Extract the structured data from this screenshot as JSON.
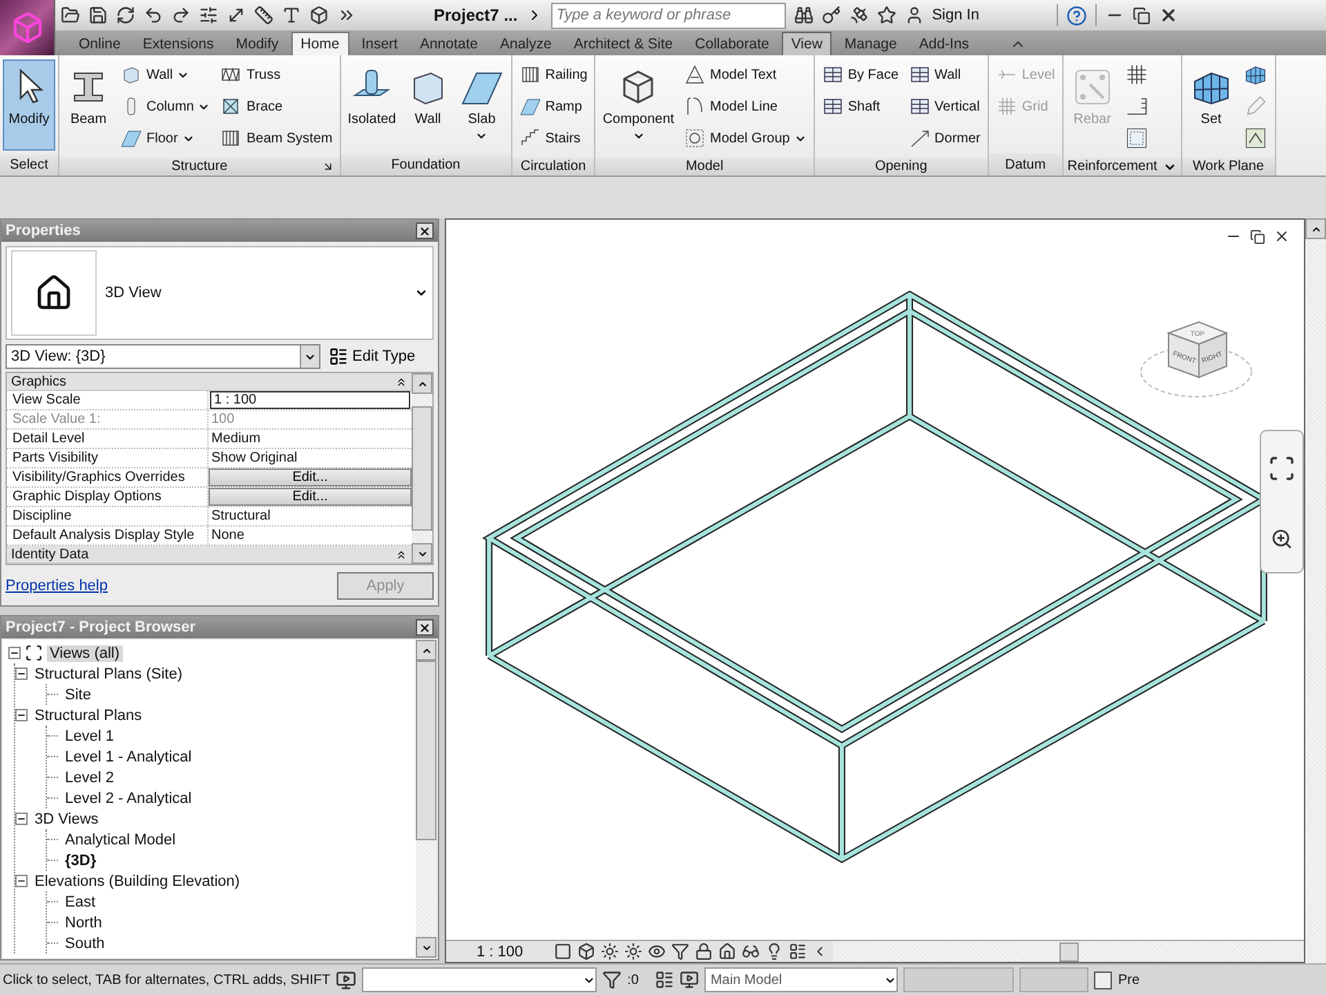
{
  "app": {
    "title": "Project7 ...",
    "search": {
      "placeholder": "Type a keyword or phrase"
    },
    "sign_in": "Sign In"
  },
  "tabs": [
    {
      "label": "Online",
      "selected": false,
      "hovered": false
    },
    {
      "label": "Extensions",
      "selected": false,
      "hovered": false
    },
    {
      "label": "Modify",
      "selected": false,
      "hovered": false
    },
    {
      "label": "Home",
      "selected": true,
      "hovered": false
    },
    {
      "label": "Insert",
      "selected": false,
      "hovered": false
    },
    {
      "label": "Annotate",
      "selected": false,
      "hovered": false
    },
    {
      "label": "Analyze",
      "selected": false,
      "hovered": false
    },
    {
      "label": "Architect & Site",
      "selected": false,
      "hovered": false
    },
    {
      "label": "Collaborate",
      "selected": false,
      "hovered": false
    },
    {
      "label": "View",
      "selected": false,
      "hovered": true
    },
    {
      "label": "Manage",
      "selected": false,
      "hovered": false
    },
    {
      "label": "Add-Ins",
      "selected": false,
      "hovered": false
    }
  ],
  "ribbon": [
    {
      "title": "Select",
      "columns": [
        [
          {
            "label": "Modify",
            "kind": "large",
            "selected": true,
            "disabled": false
          }
        ]
      ]
    },
    {
      "title": "Structure",
      "launcher": true,
      "columns": [
        [
          {
            "label": "Beam",
            "kind": "large",
            "selected": false,
            "disabled": false
          }
        ],
        [
          {
            "label": "Wall",
            "kind": "small",
            "dropdown": true,
            "selected": false,
            "disabled": false
          },
          {
            "label": "Column",
            "kind": "small",
            "dropdown": true,
            "selected": false,
            "disabled": false
          },
          {
            "label": "Floor",
            "kind": "small",
            "dropdown": true,
            "selected": false,
            "disabled": false
          }
        ],
        [
          {
            "label": "Truss",
            "kind": "small",
            "selected": false,
            "disabled": false
          },
          {
            "label": "Brace",
            "kind": "small",
            "selected": false,
            "disabled": false
          },
          {
            "label": "Beam System",
            "kind": "small",
            "selected": false,
            "disabled": false
          }
        ]
      ]
    },
    {
      "title": "Foundation",
      "columns": [
        [
          {
            "label": "Isolated",
            "kind": "large",
            "selected": false,
            "disabled": false
          }
        ],
        [
          {
            "label": "Wall",
            "kind": "large",
            "selected": false,
            "disabled": false
          }
        ],
        [
          {
            "label": "Slab",
            "kind": "large",
            "dropdown": true,
            "selected": false,
            "disabled": false
          }
        ]
      ]
    },
    {
      "title": "Circulation",
      "columns": [
        [
          {
            "label": "Railing",
            "kind": "small",
            "selected": false,
            "disabled": false
          },
          {
            "label": "Ramp",
            "kind": "small",
            "selected": false,
            "disabled": false
          },
          {
            "label": "Stairs",
            "kind": "small",
            "selected": false,
            "disabled": false
          }
        ]
      ]
    },
    {
      "title": "Model",
      "columns": [
        [
          {
            "label": "Component",
            "kind": "large",
            "dropdown": true,
            "selected": false,
            "disabled": false
          }
        ],
        [
          {
            "label": "Model Text",
            "kind": "small",
            "selected": false,
            "disabled": false
          },
          {
            "label": "Model Line",
            "kind": "small",
            "selected": false,
            "disabled": false
          },
          {
            "label": "Model Group",
            "kind": "small",
            "dropdown": true,
            "selected": false,
            "disabled": false
          }
        ]
      ]
    },
    {
      "title": "Opening",
      "columns": [
        [
          {
            "label": "By Face",
            "kind": "small",
            "selected": false,
            "disabled": false
          },
          {
            "label": "Shaft",
            "kind": "small",
            "selected": false,
            "disabled": false
          }
        ],
        [
          {
            "label": "Wall",
            "kind": "small",
            "selected": false,
            "disabled": false
          },
          {
            "label": "Vertical",
            "kind": "small",
            "selected": false,
            "disabled": false
          },
          {
            "label": "Dormer",
            "kind": "small",
            "selected": false,
            "disabled": false
          }
        ]
      ]
    },
    {
      "title": "Datum",
      "columns": [
        [
          {
            "label": "Level",
            "kind": "small",
            "selected": false,
            "disabled": true
          },
          {
            "label": "Grid",
            "kind": "small",
            "selected": false,
            "disabled": true
          }
        ]
      ]
    },
    {
      "title": "Reinforcement",
      "menu": true,
      "columns": [
        [
          {
            "label": "Rebar",
            "kind": "large",
            "selected": false,
            "disabled": true
          }
        ],
        [
          {
            "kind": "icon",
            "selected": false,
            "disabled": false
          },
          {
            "kind": "icon",
            "selected": false,
            "disabled": false
          },
          {
            "kind": "icon",
            "selected": false,
            "disabled": false
          }
        ]
      ]
    },
    {
      "title": "Work Plane",
      "columns": [
        [
          {
            "label": "Set",
            "kind": "large",
            "selected": false,
            "disabled": false
          }
        ],
        [
          {
            "kind": "icon",
            "selected": false,
            "disabled": false
          },
          {
            "kind": "icon",
            "selected": false,
            "disabled": true
          },
          {
            "kind": "icon",
            "selected": false,
            "disabled": false
          }
        ]
      ]
    }
  ],
  "properties": {
    "title": "Properties",
    "type_name": "3D View",
    "instance": "3D View: {3D}",
    "edit_type": "Edit Type",
    "groups": [
      {
        "name": "Graphics",
        "expanded": true,
        "rows": [
          {
            "name": "View Scale",
            "value": "1 : 100",
            "kind": "input",
            "disabled": false
          },
          {
            "name": "Scale Value    1:",
            "value": "100",
            "kind": "text",
            "disabled": true
          },
          {
            "name": "Detail Level",
            "value": "Medium",
            "kind": "text",
            "disabled": false
          },
          {
            "name": "Parts Visibility",
            "value": "Show Original",
            "kind": "text",
            "disabled": false
          },
          {
            "name": "Visibility/Graphics Overrides",
            "value": "Edit...",
            "kind": "button",
            "disabled": false
          },
          {
            "name": "Graphic Display Options",
            "value": "Edit...",
            "kind": "button",
            "disabled": false
          },
          {
            "name": "Discipline",
            "value": "Structural",
            "kind": "text",
            "disabled": false
          },
          {
            "name": "Default Analysis Display Style",
            "value": "None",
            "kind": "text",
            "disabled": false
          }
        ]
      },
      {
        "name": "Identity Data",
        "expanded": true
      }
    ],
    "help": "Properties help",
    "apply": {
      "label": "Apply",
      "disabled": true
    }
  },
  "browser": {
    "title": "Project7 - Project Browser",
    "tree": [
      {
        "label": "Views (all)",
        "expanded": true,
        "selected": true,
        "current": false,
        "children": [
          {
            "label": "Structural Plans (Site)",
            "expanded": true,
            "selected": false,
            "current": false,
            "children": [
              {
                "label": "Site",
                "selected": false,
                "current": false
              }
            ]
          },
          {
            "label": "Structural Plans",
            "expanded": true,
            "selected": false,
            "current": false,
            "children": [
              {
                "label": "Level 1",
                "selected": false,
                "current": false
              },
              {
                "label": "Level 1 - Analytical",
                "selected": false,
                "current": false
              },
              {
                "label": "Level 2",
                "selected": false,
                "current": false
              },
              {
                "label": "Level 2 - Analytical",
                "selected": false,
                "current": false
              }
            ]
          },
          {
            "label": "3D Views",
            "expanded": true,
            "selected": false,
            "current": false,
            "children": [
              {
                "label": "Analytical Model",
                "selected": false,
                "current": false
              },
              {
                "label": "{3D}",
                "selected": false,
                "current": true
              }
            ]
          },
          {
            "label": "Elevations (Building Elevation)",
            "expanded": true,
            "selected": false,
            "current": false,
            "children": [
              {
                "label": "East",
                "selected": false,
                "current": false
              },
              {
                "label": "North",
                "selected": false,
                "current": false
              },
              {
                "label": "South",
                "selected": false,
                "current": false
              }
            ]
          }
        ]
      }
    ]
  },
  "viewcube": {
    "top": "TOP",
    "front": "FRONT",
    "right": "RIGHT"
  },
  "view_bar": {
    "scale": "1 : 100"
  },
  "status_bar": {
    "message": "Click to select, TAB for alternates, CTRL adds, SHIFT",
    "filter_count": ":0",
    "model": "Main Model",
    "press_drag": {
      "label": "Pre",
      "checked": false
    }
  }
}
